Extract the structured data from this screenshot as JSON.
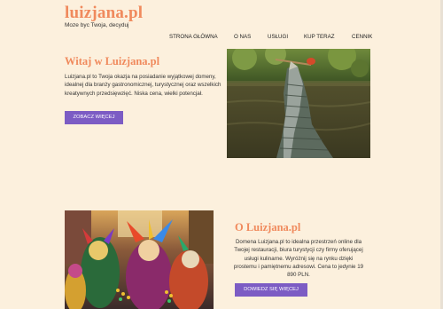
{
  "header": {
    "logo": "luizjana.pl",
    "tagline": "Moze byc Twoja, decyduj"
  },
  "nav": {
    "items": [
      "STRONA GŁÓWNA",
      "O NAS",
      "USŁUGI",
      "KUP TERAZ",
      "CENNIK"
    ]
  },
  "hero": {
    "title": "Witaj w Luizjana.pl",
    "text": "Luizjana.pl to Twoja okazja na posiadanie wyjątkowej domeny, idealnej dla branży gastronomicznej, turystycznej oraz wszelkich kreatywnych przedsięwzięć. Niska cena, wielki potencjał.",
    "button": "ZOBACZ WIĘCEJ"
  },
  "about": {
    "title": "O Luizjana.pl",
    "text": "Domena Luizjana.pl to idealna przestrzeń online dla Twojej restauracji, biura turystycji czy firmy oferującej usługi kulinarne. Wyróżnij się na rynku dzięki prostemu i pamiętnemu adresowi. Cena to jedynie 19 890 PLN.",
    "button": "DOWIEDZ SIĘ WIĘCEJ"
  },
  "colors": {
    "background": "#fcf0dd",
    "accent": "#f08a5d",
    "button": "#7c5cc4"
  },
  "images": {
    "hero": "alligator-photo",
    "about": "carnival-masks-photo"
  }
}
